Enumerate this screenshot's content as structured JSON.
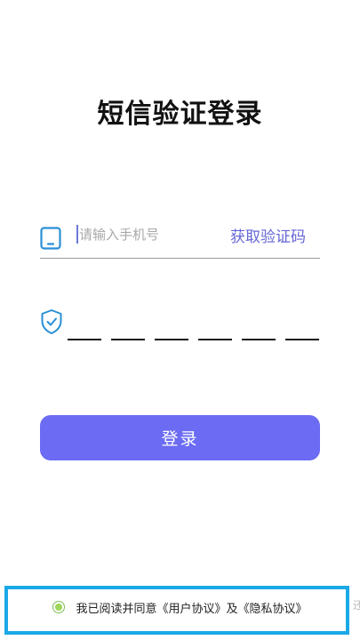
{
  "page": {
    "title": "短信验证登录"
  },
  "phone": {
    "placeholder": "请输入手机号",
    "value": "",
    "get_code_label": "获取验证码"
  },
  "code": {
    "digits": [
      "",
      "",
      "",
      "",
      "",
      ""
    ]
  },
  "actions": {
    "login_label": "登录"
  },
  "agreement": {
    "checked": true,
    "prefix": "我已阅读并同意",
    "user_agreement": "《用户协议》",
    "and": "及",
    "privacy_agreement": "《隐私协议》"
  },
  "edge_mark": "还",
  "colors": {
    "accent": "#6b6bf3",
    "link": "#6566d6",
    "icon": "#2b8fd6",
    "highlight_border": "#1aa9e6",
    "radio_fill": "#9ed65b"
  },
  "icons": {
    "phone": "mobile-phone-icon",
    "shield": "shield-check-icon"
  }
}
